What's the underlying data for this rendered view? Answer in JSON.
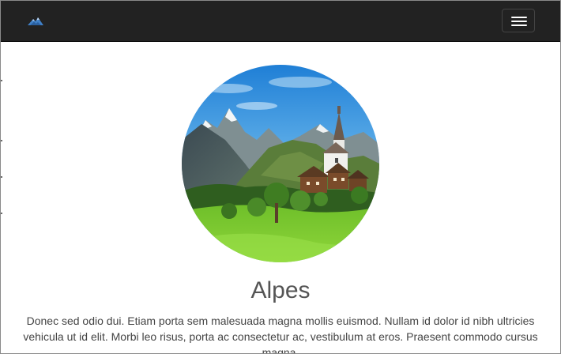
{
  "navbar": {
    "brand_icon": "mountain-logo-icon",
    "menu_icon": "hamburger-menu-icon",
    "background": "#222222"
  },
  "hero": {
    "image": "alpine-village-photo",
    "title": "Alpes",
    "description": "Donec sed odio dui. Etiam porta sem malesuada magna mollis euismod. Nullam id dolor id nibh ultricies vehicula ut id elit. Morbi leo risus, porta ac consectetur ac, vestibulum at eros. Praesent commodo cursus magna."
  }
}
